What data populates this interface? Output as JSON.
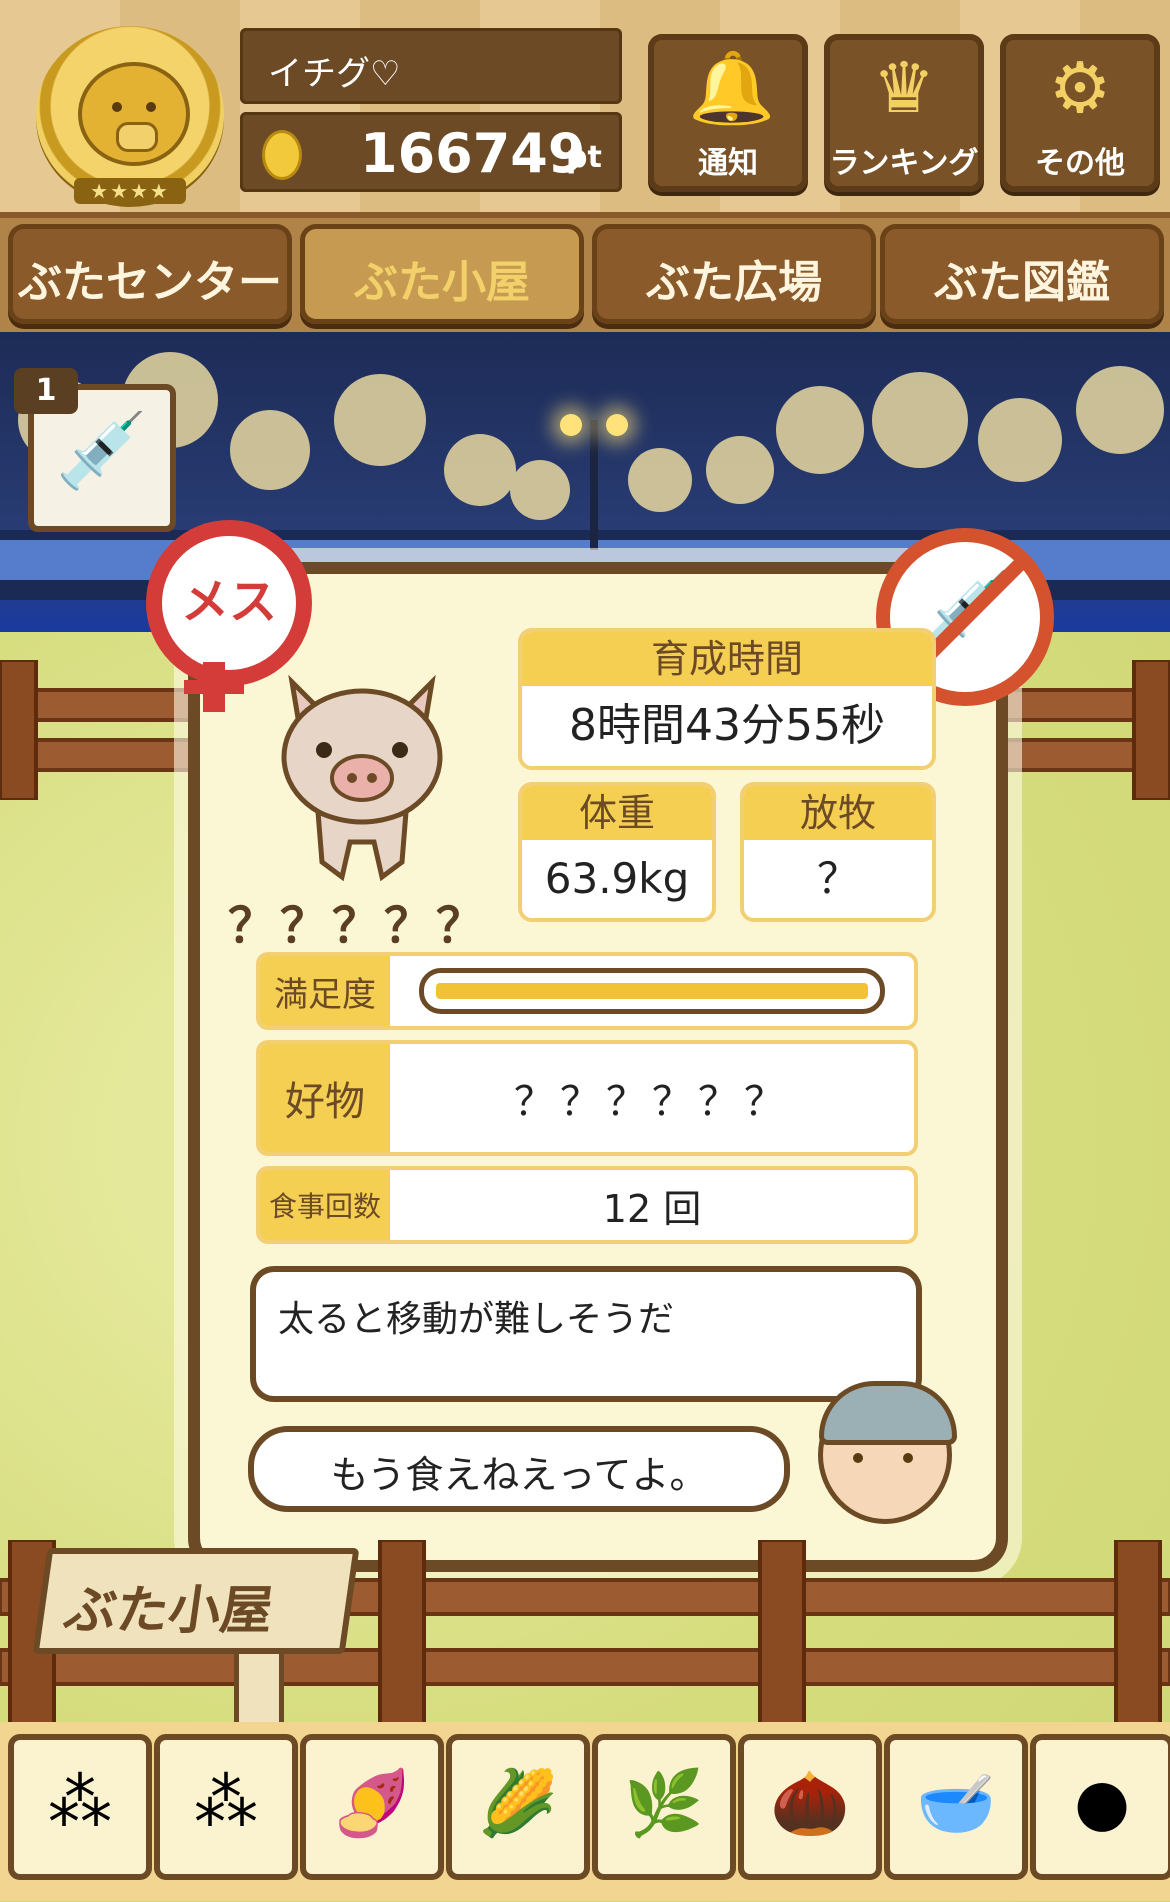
{
  "header": {
    "username": "イチグ♡",
    "points": "166749",
    "points_unit": "pt",
    "buttons": [
      {
        "label": "通知",
        "icon": "bell-icon"
      },
      {
        "label": "ランキング",
        "icon": "crown-icon"
      },
      {
        "label": "その他",
        "icon": "gear-icon"
      }
    ]
  },
  "tabs": [
    "ぶたセンター",
    "ぶた小屋",
    "ぶた広場",
    "ぶた図鑑"
  ],
  "active_tab": "ぶた小屋",
  "item": {
    "count": "1",
    "icon": "syringe-icon"
  },
  "pig": {
    "gender_label": "メス",
    "name": "？？？？？",
    "growth_time_label": "育成時間",
    "growth_time_value": "8時間43分55秒",
    "weight_label": "体重",
    "weight_value": "63.9kg",
    "grazing_label": "放牧",
    "grazing_value": "？",
    "satisfaction_label": "満足度",
    "satisfaction_level": 1.0,
    "favorite_label": "好物",
    "favorite_value": "？？？？？？",
    "meals_label": "食事回数",
    "meals_value": "12 回",
    "comment": "太ると移動が難しそうだ",
    "farmer_line": "もう食えねえってよ。"
  },
  "sign": "ぶた小屋",
  "foods": [
    "grain-pile-icon",
    "mixed-grain-icon",
    "sweet-potato-icon",
    "corn-icon",
    "herbs-icon",
    "acorn-icon",
    "grain-bowl-icon",
    "truffle-icon"
  ],
  "colors": {
    "wood_dark": "#6b4a25",
    "gold": "#f5cf52",
    "female_red": "#d43c3a"
  }
}
